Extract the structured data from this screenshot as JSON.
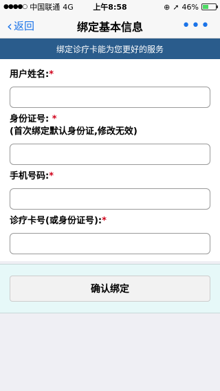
{
  "status_bar": {
    "signal": "●●●●○",
    "carrier": "中国联通",
    "network": "4G",
    "time": "上午8:58",
    "battery_percent": "46%",
    "battery_level": 0.46
  },
  "nav": {
    "back_label": "返回",
    "title": "绑定基本信息",
    "more_label": "•••"
  },
  "banner": {
    "text": "绑定诊疗卡能为您更好的服务"
  },
  "form": {
    "name_label": "用户姓名:",
    "id_label": "身份证号: ",
    "id_note": "(首次绑定默认身份证,修改无效)",
    "phone_label": "手机号码:",
    "card_label": "诊疗卡号(或身份证号):",
    "required_mark": "*",
    "name_value": "",
    "id_value": "",
    "phone_value": "",
    "card_value": ""
  },
  "actions": {
    "confirm_label": "确认绑定"
  },
  "colors": {
    "accent": "#1a73e8",
    "banner": "#2a5c8c",
    "required": "#d0021b",
    "battery": "#4cd964"
  }
}
